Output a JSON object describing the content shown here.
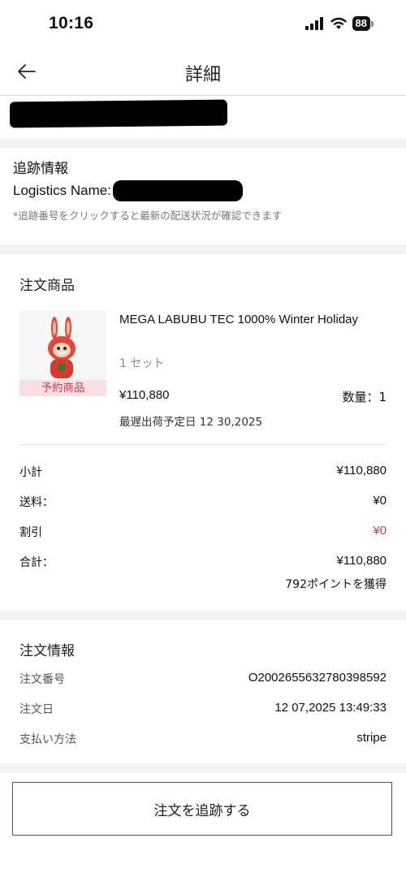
{
  "status": {
    "time": "10:16",
    "battery": "88"
  },
  "nav": {
    "title": "詳細"
  },
  "tracking": {
    "title": "追跡情報",
    "logistics_label": "Logistics Name:",
    "hint": "*追跡番号をクリックすると最新の配送状況が確認できます"
  },
  "products": {
    "title": "注文商品",
    "item": {
      "name": "MEGA LABUBU TEC 1000% Winter Holiday",
      "set": "1 セット",
      "badge": "予約商品",
      "price": "¥110,880",
      "qty": "数量：1",
      "ship_date": "最遅出荷予定日 12 30,2025"
    }
  },
  "summary": {
    "subtotal_label": "小計",
    "subtotal": "¥110,880",
    "shipping_label": "送料：",
    "shipping": "¥0",
    "discount_label": "割引",
    "discount": "¥0",
    "total_label": "合計：",
    "total": "¥110,880",
    "points": "792ポイントを獲得"
  },
  "order_info": {
    "title": "注文情報",
    "number_label": "注文番号",
    "number": "O2002655632780398592",
    "date_label": "注文日",
    "date": "12 07,2025 13:49:33",
    "payment_label": "支払い方法",
    "payment": "stripe"
  },
  "actions": {
    "track_order": "注文を追跡する"
  },
  "colors": {
    "accent_red": "#d23a4e",
    "badge_bg": "#fbe0e3",
    "section_gap": "#f2f2f2"
  }
}
